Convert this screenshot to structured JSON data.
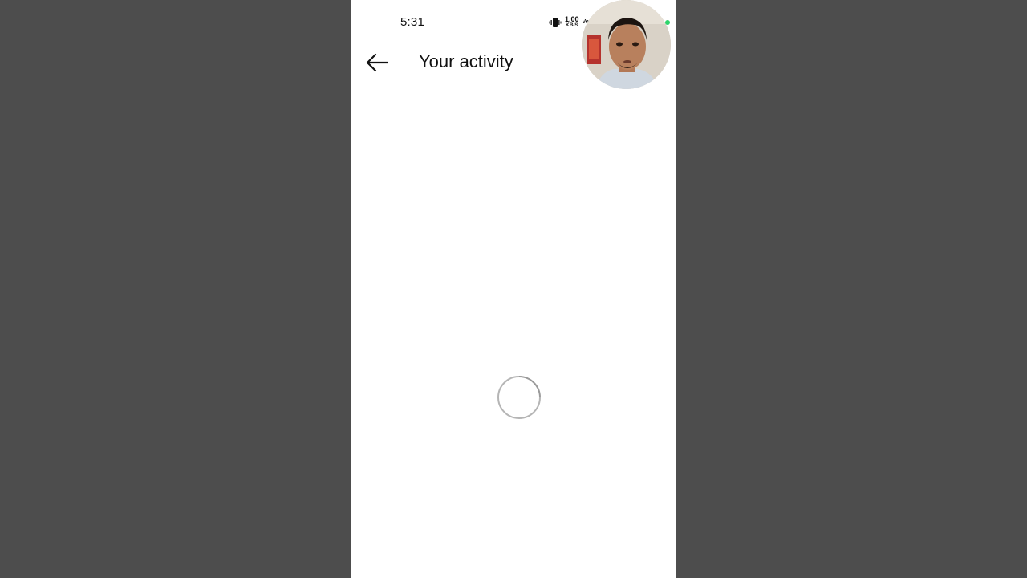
{
  "status_bar": {
    "time": "5:31",
    "net_speed_value": "1.00",
    "net_speed_unit": "KB/S",
    "carrier_partial": "Vo",
    "icons": [
      "vibrate-icon",
      "network-speed-indicator",
      "volte-indicator"
    ]
  },
  "header": {
    "back_icon": "back-arrow-icon",
    "title": "Your activity"
  },
  "content": {
    "state": "loading",
    "spinner_icon": "loading-spinner-icon"
  },
  "overlay": {
    "type": "picture-in-picture webcam bubble",
    "indicator_color": "#2fd46b"
  },
  "colors": {
    "background_outer": "#4d4d4d",
    "screen_background": "#ffffff",
    "text_primary": "#111111",
    "spinner_stroke": "#b5b5b5"
  }
}
